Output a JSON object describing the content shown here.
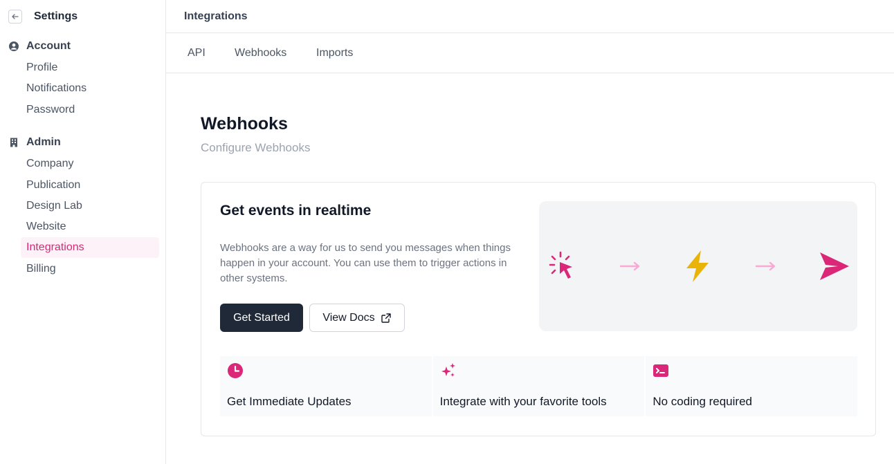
{
  "sidebar": {
    "title": "Settings",
    "back_icon": "arrow-left-icon",
    "groups": [
      {
        "label": "Account",
        "icon": "user-circle-icon",
        "items": [
          "Profile",
          "Notifications",
          "Password"
        ]
      },
      {
        "label": "Admin",
        "icon": "building-icon",
        "items": [
          "Company",
          "Publication",
          "Design Lab",
          "Website",
          "Integrations",
          "Billing"
        ]
      }
    ],
    "active_item": "Integrations"
  },
  "topbar": {
    "title": "Integrations"
  },
  "tabs": [
    "API",
    "Webhooks",
    "Imports"
  ],
  "main": {
    "title": "Webhooks",
    "subtitle": "Configure Webhooks",
    "card": {
      "title": "Get events in realtime",
      "description": "Webhooks are a way for us to send you messages when things happen in your account. You can use them to trigger actions in other systems.",
      "primary_button": "Get Started",
      "secondary_button": "View Docs",
      "secondary_icon": "external-link-icon",
      "illustration_icons": [
        "cursor-click-icon",
        "arrow-right-icon",
        "lightning-bolt-icon",
        "arrow-right-icon",
        "paper-plane-icon"
      ],
      "features": [
        {
          "label": "Get Immediate Updates",
          "icon": "clock-icon"
        },
        {
          "label": "Integrate with your favorite tools",
          "icon": "sparkles-icon"
        },
        {
          "label": "No coding required",
          "icon": "terminal-icon"
        }
      ]
    }
  },
  "colors": {
    "accent": "#db2777",
    "accent_light": "#f9a8d4",
    "bolt": "#eab308",
    "primary_button": "#1f2937",
    "active_bg": "#fdf2f8"
  }
}
